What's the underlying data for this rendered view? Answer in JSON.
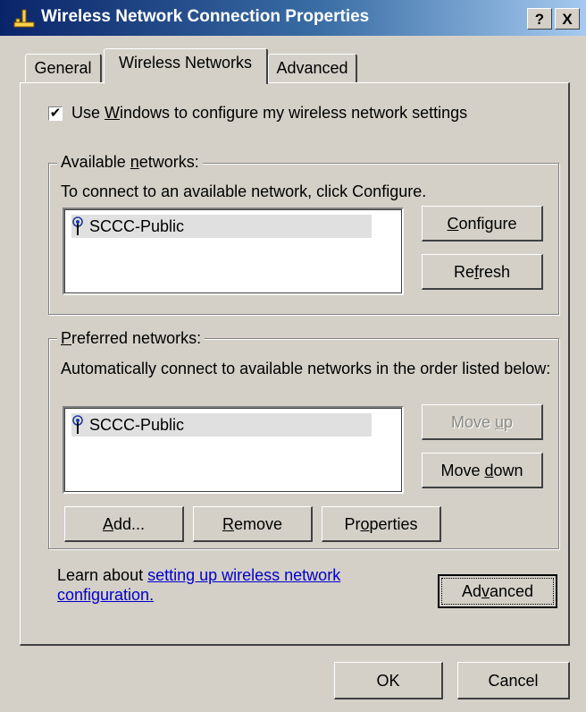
{
  "window": {
    "title": "Wireless Network Connection Properties",
    "help_label": "?",
    "close_label": "X",
    "title_icon": "network-connection-icon"
  },
  "tabs": [
    {
      "label": "General",
      "active": false
    },
    {
      "label": "Wireless Networks",
      "active": true
    },
    {
      "label": "Advanced",
      "active": false
    }
  ],
  "use_windows": {
    "checked": true,
    "mark": "✔",
    "label_pre": "Use ",
    "label_mnemonic": "W",
    "label_post": "indows to configure my wireless network settings"
  },
  "available": {
    "legend_pre": "Available ",
    "legend_mnemonic": "n",
    "legend_post": "etworks:",
    "description": "To connect to an available network, click Configure.",
    "networks": [
      "SCCC-Public"
    ],
    "configure_mnemonic": "C",
    "configure_rest": "onfigure",
    "refresh_pre": "Re",
    "refresh_mnemonic": "f",
    "refresh_post": "resh"
  },
  "preferred": {
    "legend_mnemonic": "P",
    "legend_rest": "referred networks:",
    "description": "Automatically connect to available networks in the order listed below:",
    "networks": [
      "SCCC-Public"
    ],
    "move_up_pre": "Move ",
    "move_up_mnemonic": "u",
    "move_up_post": "p",
    "move_down_pre": "Move ",
    "move_down_mnemonic": "d",
    "move_down_post": "own",
    "add_mnemonic": "A",
    "add_rest": "dd...",
    "remove_mnemonic": "R",
    "remove_rest": "emove",
    "properties_pre": "Pr",
    "properties_mnemonic": "o",
    "properties_post": "perties"
  },
  "learn": {
    "text": "Learn about ",
    "link_text": "setting up wireless network configuration."
  },
  "advanced_button": {
    "pre": "Ad",
    "mnemonic": "v",
    "post": "anced"
  },
  "footer": {
    "ok_label": "OK",
    "cancel_label": "Cancel"
  }
}
